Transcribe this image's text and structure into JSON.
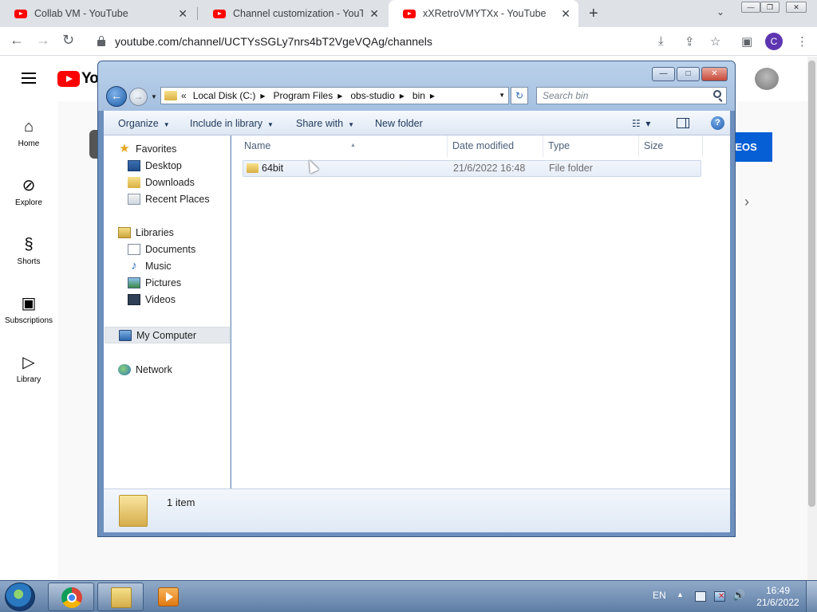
{
  "browser": {
    "tabs": [
      {
        "title": "Collab VM - YouTube",
        "active": false
      },
      {
        "title": "Channel customization - YouTube",
        "active": false
      },
      {
        "title": "xXRetroVMYTXx - YouTube",
        "active": true
      }
    ],
    "tab_close": "✕",
    "new_tab": "+",
    "url": "youtube.com/channel/UCTYsSGLy7nrs4bT2VgeVQAg/channels",
    "profile_initial": "C",
    "icons": [
      "back-icon",
      "forward-icon",
      "reload-icon",
      "lock-icon",
      "install-icon",
      "share-icon",
      "bookmark-star-icon",
      "side-panel-icon",
      "menu-icon"
    ]
  },
  "youtube": {
    "logo_text": "Yo",
    "guide": [
      {
        "label": "Home",
        "icon": "⌂"
      },
      {
        "label": "Explore",
        "icon": "⊘"
      },
      {
        "label": "Shorts",
        "icon": "§"
      },
      {
        "label": "Subscriptions",
        "icon": "▣"
      },
      {
        "label": "Library",
        "icon": "▷"
      }
    ],
    "videos_button": "DEOS",
    "chevron": "›"
  },
  "explorer": {
    "caption_buttons": {
      "minimize": "—",
      "maximize": "□",
      "close": "✕"
    },
    "address": {
      "overflow": "«",
      "crumbs": [
        "Local Disk (C:)",
        "Program Files",
        "obs-studio",
        "bin"
      ],
      "separator": "▶"
    },
    "search_placeholder": "Search bin",
    "commands": [
      {
        "label": "Organize",
        "dropdown": true
      },
      {
        "label": "Include in library",
        "dropdown": true
      },
      {
        "label": "Share with",
        "dropdown": true
      },
      {
        "label": "New folder",
        "dropdown": false
      }
    ],
    "nav": {
      "favorites_header": "Favorites",
      "favorites": [
        "Desktop",
        "Downloads",
        "Recent Places"
      ],
      "libraries_header": "Libraries",
      "libraries": [
        "Documents",
        "Music",
        "Pictures",
        "Videos"
      ],
      "computer": "My Computer",
      "network": "Network"
    },
    "columns": {
      "name": "Name",
      "date": "Date modified",
      "type": "Type",
      "size": "Size"
    },
    "files": [
      {
        "name": "64bit",
        "date": "21/6/2022 16:48",
        "type": "File folder",
        "size": ""
      }
    ],
    "status": "1 item"
  },
  "taskbar": {
    "language": "EN",
    "time": "16:49",
    "date": "21/6/2022",
    "pinned": [
      "chrome-icon",
      "explorer-icon",
      "media-player-icon"
    ]
  },
  "colors": {
    "youtube_red": "#ff0000",
    "youtube_blue": "#065fd4",
    "taskbar": "#6f8db3",
    "explorer_frame": "#a6c0e0"
  }
}
